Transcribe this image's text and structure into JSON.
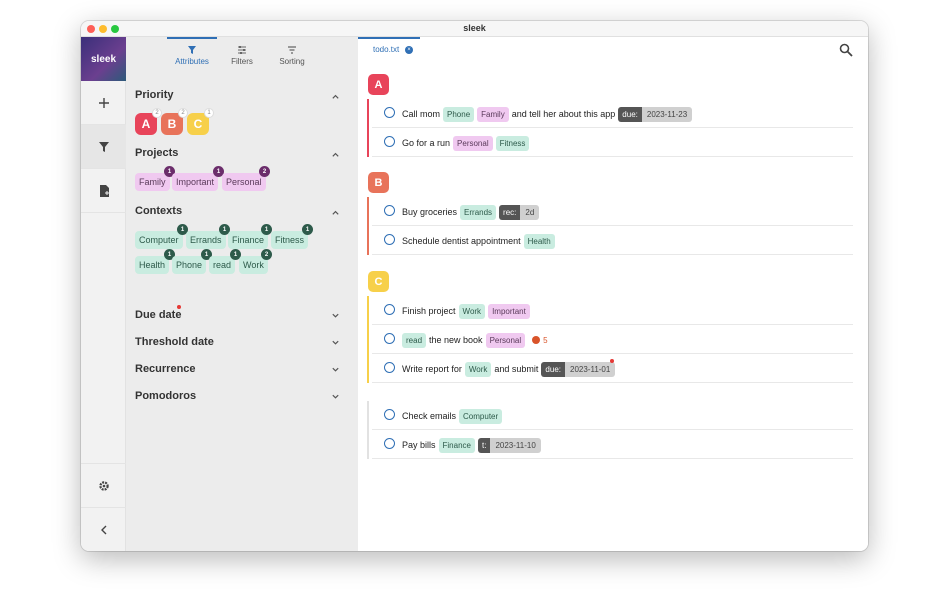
{
  "window": {
    "title": "sleek"
  },
  "nav": {
    "logo": "sleek"
  },
  "sidebar": {
    "tabs": [
      {
        "label": "Attributes",
        "icon": "filter-icon",
        "active": true
      },
      {
        "label": "Filters",
        "icon": "sliders-icon"
      },
      {
        "label": "Sorting",
        "icon": "sort-icon"
      }
    ],
    "priority": {
      "title": "Priority",
      "badges": [
        {
          "label": "A",
          "count": "2",
          "color": "#e8445a"
        },
        {
          "label": "B",
          "count": "2",
          "color": "#e8735a"
        },
        {
          "label": "C",
          "count": "1",
          "color": "#f7d04a"
        }
      ]
    },
    "projects": {
      "title": "Projects",
      "chips": [
        {
          "label": "Family",
          "count": "1"
        },
        {
          "label": "Important",
          "count": "1"
        },
        {
          "label": "Personal",
          "count": "2"
        }
      ]
    },
    "contexts": {
      "title": "Contexts",
      "chips": [
        {
          "label": "Computer",
          "count": "1"
        },
        {
          "label": "Errands",
          "count": "1"
        },
        {
          "label": "Finance",
          "count": "1"
        },
        {
          "label": "Fitness",
          "count": "1"
        },
        {
          "label": "Health",
          "count": "1"
        },
        {
          "label": "Phone",
          "count": "1"
        },
        {
          "label": "read",
          "count": "1"
        },
        {
          "label": "Work",
          "count": "2"
        }
      ]
    },
    "due_date": "Due date",
    "threshold_date": "Threshold date",
    "recurrence": "Recurrence",
    "pomodoros": "Pomodoros"
  },
  "main": {
    "file_tab": "todo.txt",
    "groups": {
      "a": {
        "label": "A",
        "color": "#e8445a"
      },
      "b": {
        "label": "B",
        "color": "#e8735a"
      },
      "c": {
        "label": "C",
        "color": "#f7d04a"
      }
    },
    "todos": {
      "t1": {
        "text1": "Call mom",
        "ctx": "Phone",
        "proj": "Family",
        "text2": "and tell her about this app",
        "due_k": "due:",
        "due_v": "2023-11-23"
      },
      "t2": {
        "text1": "Go for a run",
        "proj": "Personal",
        "ctx": "Fitness"
      },
      "t3": {
        "text1": "Buy groceries",
        "ctx": "Errands",
        "rec_k": "rec:",
        "rec_v": "2d"
      },
      "t4": {
        "text1": "Schedule dentist appointment",
        "ctx": "Health"
      },
      "t5": {
        "text1": "Finish project",
        "ctx": "Work",
        "proj": "Important"
      },
      "t6": {
        "ctx": "read",
        "text1": "the new book",
        "proj": "Personal",
        "pomodoros": "5"
      },
      "t7": {
        "text1": "Write report for",
        "ctx": "Work",
        "text2": "and submit",
        "due_k": "due:",
        "due_v": "2023-11-01"
      },
      "t8": {
        "text1": "Check emails",
        "ctx": "Computer"
      },
      "t9": {
        "text1": "Pay bills",
        "ctx": "Finance",
        "t_k": "t:",
        "t_v": "2023-11-10"
      }
    }
  }
}
